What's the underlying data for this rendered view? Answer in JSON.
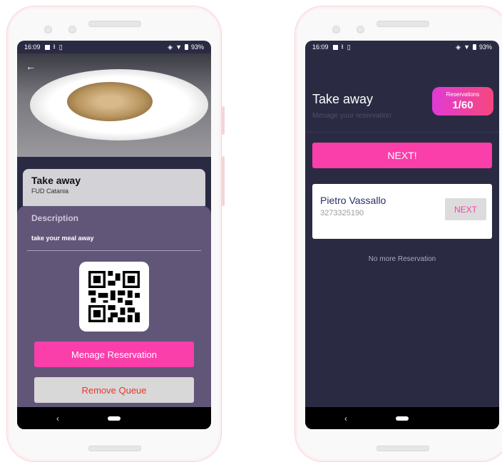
{
  "left_phone": {
    "status": {
      "time": "16:09",
      "battery": "93%"
    },
    "title": "Take away",
    "subtitle": "FUD  Catania",
    "description_title": "Description",
    "description_text": "take your meal away",
    "buttons": {
      "manage": "Menage Reservation",
      "remove": "Remove Queue"
    }
  },
  "right_phone": {
    "status": {
      "time": "16:09",
      "battery": "93%"
    },
    "title": "Take away",
    "subtitle": "Menage your reservation",
    "badge": {
      "label": "Reservations",
      "value": "1/60"
    },
    "next_button": "NEXT!",
    "reservation": {
      "name": "Pietro Vassallo",
      "phone": "3273325190",
      "button": "NEXT"
    },
    "empty_text": "No more Reservation"
  },
  "colors": {
    "accent_pink": "#fa3eaa",
    "dark_bg": "#2a2b43",
    "card_purple": "#615678",
    "danger_text": "#e2392c"
  }
}
